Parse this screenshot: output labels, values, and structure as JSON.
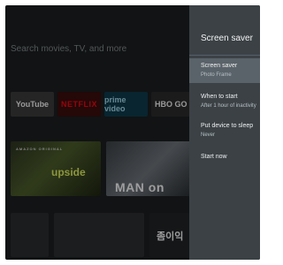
{
  "home": {
    "search_placeholder": "Search movies, TV, and more",
    "apps": [
      {
        "label": "YouTube"
      },
      {
        "label": "NETFLIX"
      },
      {
        "label": "prime video"
      },
      {
        "label": "HBO GO"
      }
    ],
    "tiles": [
      {
        "title": "upside",
        "subtitle": "AMAZON ORIGINAL"
      },
      {
        "title": "MAN on FIRE"
      },
      {
        "title": "좀이익"
      }
    ]
  },
  "panel": {
    "title": "Screen saver",
    "items": [
      {
        "label": "Screen saver",
        "value": "Photo Frame",
        "focused": true
      },
      {
        "label": "When to start",
        "value": "After 1 hour of inactivity",
        "focused": false
      },
      {
        "label": "Put device to sleep",
        "value": "Never",
        "focused": false
      },
      {
        "label": "Start now",
        "value": "",
        "focused": false
      }
    ]
  },
  "colors": {
    "panel_bg": "#3b4145",
    "panel_focus": "#5a6369",
    "home_bg": "#1b1e20"
  }
}
